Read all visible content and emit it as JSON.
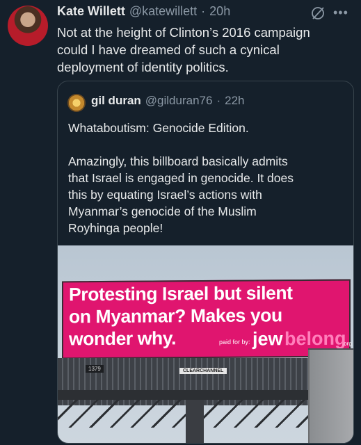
{
  "tweet": {
    "author_name": "Kate Willett",
    "author_handle": "@katewillett",
    "separator": "·",
    "time": "20h",
    "text": "Not at the height of Clinton’s 2016 campaign\ncould I have dreamed of such a cynical\ndeployment of identity politics.",
    "icons": [
      "grok-icon",
      "more-icon"
    ]
  },
  "quote": {
    "author_name": "gil duran",
    "author_handle": "@gilduran76",
    "separator": "·",
    "time": "22h",
    "text": "Whataboutism: Genocide Edition.\n\nAmazingly, this billboard basically admits\nthat Israel is engaged in genocide. It does\nthis by equating Israel’s actions with\nMyanmar’s genocide of the Muslim\nRoyhinga people!"
  },
  "billboard": {
    "line1": "Protesting Israel but silent",
    "line2": "on Myanmar? Makes you",
    "line3": "wonder why.",
    "paid_for": "paid for by:",
    "brand_jew": "jew",
    "brand_belong": "belong",
    "brand_org": ".org",
    "panel_number": "1379",
    "operator": "CLEARCHANNEL",
    "colors": {
      "background": "#e0156f",
      "belong_text": "#ff7fbb"
    }
  }
}
